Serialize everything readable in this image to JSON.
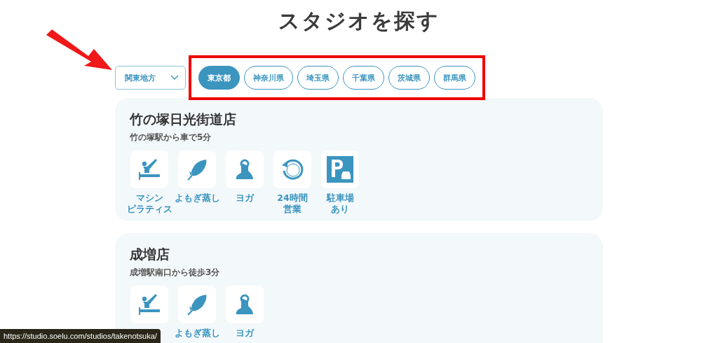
{
  "page_title": "スタジオを探す",
  "annotation_arrow": true,
  "region_select": {
    "value": "関東地方"
  },
  "highlight_tabs": true,
  "tabs": [
    {
      "label": "東京都",
      "selected": true
    },
    {
      "label": "神奈川県",
      "selected": false
    },
    {
      "label": "埼玉県",
      "selected": false
    },
    {
      "label": "千葉県",
      "selected": false
    },
    {
      "label": "茨城県",
      "selected": false
    },
    {
      "label": "群馬県",
      "selected": false
    }
  ],
  "studios": [
    {
      "name": "竹の塚日光街道店",
      "access": "竹の塚駅から車で5分",
      "features": [
        {
          "kind": "machine",
          "label": [
            "マシン",
            "ピラティス"
          ]
        },
        {
          "kind": "yomogi",
          "label": [
            "よもぎ蒸し"
          ]
        },
        {
          "kind": "yoga",
          "label": [
            "ヨガ"
          ]
        },
        {
          "kind": "clock",
          "label": [
            "24時間",
            "営業"
          ]
        },
        {
          "kind": "parking",
          "label": [
            "駐車場",
            "あり"
          ]
        }
      ]
    },
    {
      "name": "成増店",
      "access": "成増駅南口から徒歩3分",
      "features": [
        {
          "kind": "machine"
        },
        {
          "kind": "yomogi",
          "label": [
            "よもぎ蒸し"
          ]
        },
        {
          "kind": "yoga",
          "label": [
            "ヨガ"
          ]
        }
      ]
    }
  ],
  "link_preview": "https://studio.soelu.com/studios/takenotsuka/"
}
